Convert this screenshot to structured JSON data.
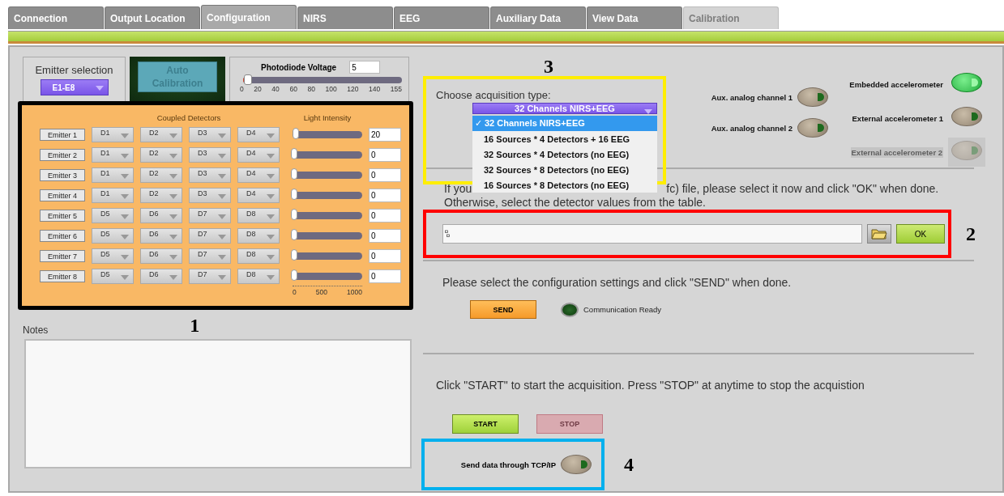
{
  "tabs": [
    {
      "label": "Connection",
      "selected": false,
      "disabled": false
    },
    {
      "label": "Output Location",
      "selected": false,
      "disabled": false
    },
    {
      "label": "Configuration",
      "selected": true,
      "disabled": false
    },
    {
      "label": "NIRS",
      "selected": false,
      "disabled": false
    },
    {
      "label": "EEG",
      "selected": false,
      "disabled": false
    },
    {
      "label": "Auxiliary Data",
      "selected": false,
      "disabled": false
    },
    {
      "label": "View Data",
      "selected": false,
      "disabled": false
    },
    {
      "label": "Calibration",
      "selected": false,
      "disabled": true
    }
  ],
  "emitter_selection": {
    "label": "Emitter selection",
    "value": "E1-E8"
  },
  "auto_calibration": {
    "label": "Auto Calibration"
  },
  "photodiode_voltage": {
    "label": "Photodiode Voltage",
    "value": "5",
    "level": 0.03,
    "ticks": [
      "0",
      "20",
      "40",
      "60",
      "80",
      "100",
      "120",
      "140",
      "155"
    ]
  },
  "emitters": {
    "heading": "Coupled Detectors",
    "intensity_heading": "Light Intensity",
    "intensity_ticks": [
      "0",
      "500",
      "1000"
    ],
    "rows": [
      {
        "label": "Emitter 1",
        "detectors": [
          "D1",
          "D2",
          "D3",
          "D4"
        ],
        "level": 0.02,
        "value": "20"
      },
      {
        "label": "Emitter 2",
        "detectors": [
          "D1",
          "D2",
          "D3",
          "D4"
        ],
        "level": 0,
        "value": "0"
      },
      {
        "label": "Emitter 3",
        "detectors": [
          "D1",
          "D2",
          "D3",
          "D4"
        ],
        "level": 0,
        "value": "0"
      },
      {
        "label": "Emitter 4",
        "detectors": [
          "D1",
          "D2",
          "D3",
          "D4"
        ],
        "level": 0,
        "value": "0"
      },
      {
        "label": "Emitter 5",
        "detectors": [
          "D5",
          "D6",
          "D7",
          "D8"
        ],
        "level": 0,
        "value": "0"
      },
      {
        "label": "Emitter 6",
        "detectors": [
          "D5",
          "D6",
          "D7",
          "D8"
        ],
        "level": 0,
        "value": "0"
      },
      {
        "label": "Emitter 7",
        "detectors": [
          "D5",
          "D6",
          "D7",
          "D8"
        ],
        "level": 0,
        "value": "0"
      },
      {
        "label": "Emitter 8",
        "detectors": [
          "D5",
          "D6",
          "D7",
          "D8"
        ],
        "level": 0,
        "value": "0"
      }
    ]
  },
  "notes": {
    "label": "Notes"
  },
  "acquisition": {
    "label": "Choose acquisition type:",
    "value": "32 Channels NIRS+EEG",
    "expanded": true,
    "check_mark": "✓",
    "options": [
      {
        "label": "32 Channels NIRS+EEG",
        "selected": true
      },
      {
        "label": "16 Sources * 4 Detectors + 16 EEG",
        "selected": false
      },
      {
        "label": "32 Sources * 4 Detectors (no EEG)",
        "selected": false
      },
      {
        "label": "32 Sources * 8 Detectors (no EEG)",
        "selected": false
      },
      {
        "label": "16 Sources * 8 Detectors (no EEG)",
        "selected": false
      }
    ]
  },
  "aux_channels": [
    {
      "label": "Aux. analog channel 1",
      "on": false
    },
    {
      "label": "Aux. analog channel 2",
      "on": false
    }
  ],
  "accelerometers": [
    {
      "label": "Embedded accelerometer",
      "on": true,
      "disabled": false
    },
    {
      "label": "External accelerometer 1",
      "on": false,
      "disabled": false
    },
    {
      "label": "External accelerometer 2",
      "on": false,
      "disabled": true
    }
  ],
  "file_instructions": {
    "line_1_start": "If you",
    "line_1_end": "fc) file, please select it now and click \"OK\" when done.",
    "line_2": "Otherwise, select the detector values from the table."
  },
  "ok_button": "OK",
  "send_section": {
    "text": "Please select the configuration settings and click \"SEND\" when done.",
    "button": "SEND",
    "indicator": {
      "label": "Communication Ready",
      "on": false
    }
  },
  "acquisition_control": {
    "text": "Click \"START\" to start the acquisition. Press \"STOP\" at anytime to stop the acquistion",
    "start": "START",
    "stop": {
      "label": "STOP",
      "disabled": true
    }
  },
  "tcp": {
    "label": "Send data through TCP/IP",
    "on": false
  },
  "annotation_numbers": [
    "1",
    "2",
    "3",
    "4"
  ]
}
